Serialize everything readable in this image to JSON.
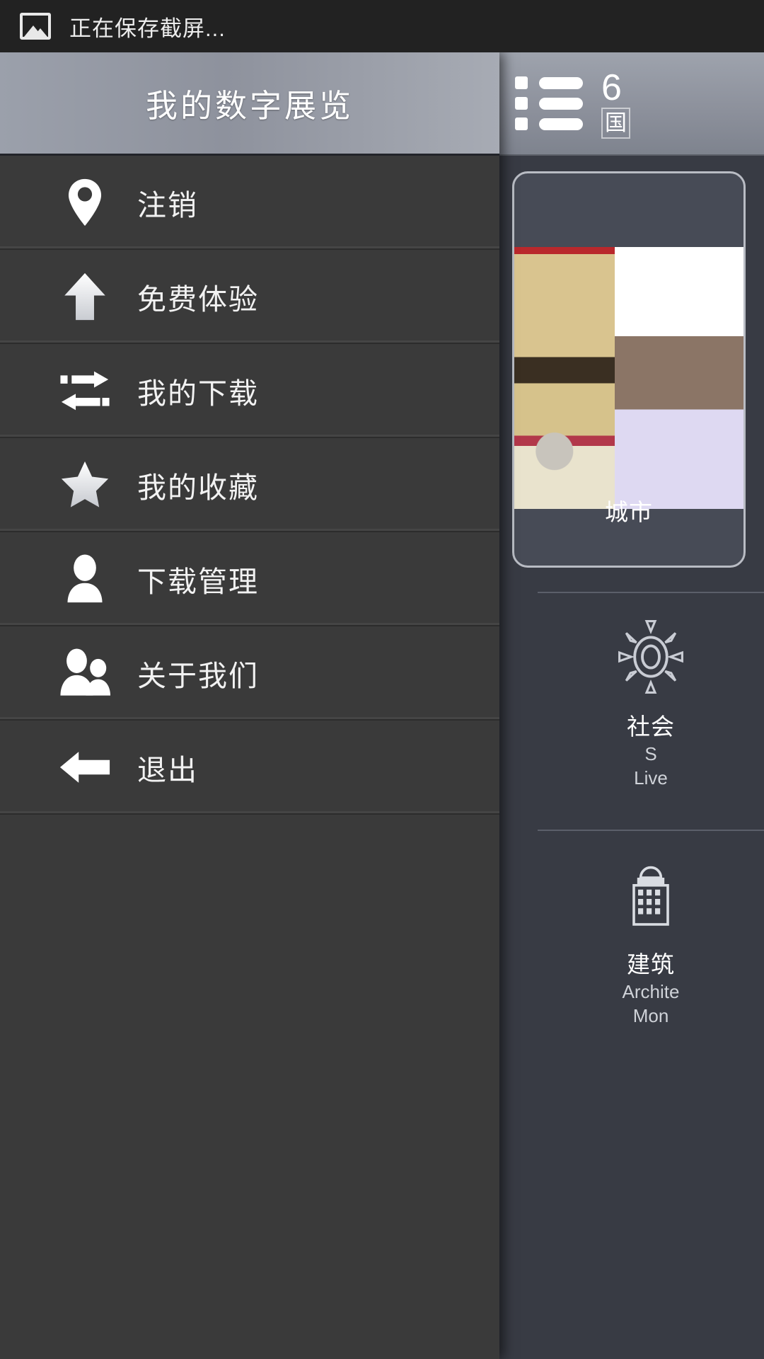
{
  "statusbar": {
    "icon": "image-icon",
    "text": "正在保存截屏..."
  },
  "drawer": {
    "title": "我的数字展览",
    "items": [
      {
        "label": "注销",
        "icon": "map-pin-icon"
      },
      {
        "label": "免费体验",
        "icon": "arrow-up-icon"
      },
      {
        "label": "我的下载",
        "icon": "swap-arrows-icon"
      },
      {
        "label": "我的收藏",
        "icon": "star-icon"
      },
      {
        "label": "下载管理",
        "icon": "person-icon"
      },
      {
        "label": "关于我们",
        "icon": "people-icon"
      },
      {
        "label": "退出",
        "icon": "arrow-left-icon"
      }
    ]
  },
  "app": {
    "menu_icon": "list-lines-icon",
    "title": "6",
    "subtitle": "国",
    "feature_card": {
      "caption": "城市"
    },
    "categories": [
      {
        "icon": "sun-rays-icon",
        "cn": "社会",
        "en_line1": "S",
        "en_line2": "Live"
      },
      {
        "icon": "building-icon",
        "cn": "建筑",
        "en_line1": "Archite",
        "en_line2": "Mon"
      }
    ]
  },
  "colors": {
    "drawer_bg": "#3a3a3a",
    "app_bg": "#383b44",
    "statusbar_bg": "#222222",
    "accent_text": "#ffffff"
  }
}
